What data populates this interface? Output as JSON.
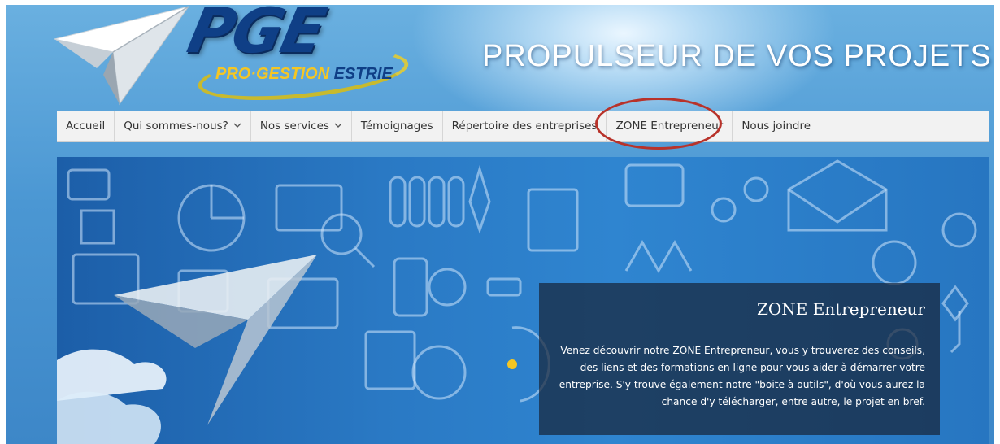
{
  "header": {
    "logo_text": "PGE",
    "logo_sub_pro": "PRO·GESTION",
    "logo_sub_estrie": "ESTRIE",
    "tagline": "PROPULSEUR DE VOS PROJETS"
  },
  "nav": {
    "items": [
      {
        "label": "Accueil"
      },
      {
        "label": "Qui sommes-nous?",
        "icon": "chevron-down-icon"
      },
      {
        "label": "Nos services",
        "icon": "chevron-down-icon"
      },
      {
        "label": "Témoignages"
      },
      {
        "label": "Répertoire des entreprises"
      },
      {
        "label": "ZONE Entrepreneur",
        "highlighted": true
      },
      {
        "label": "Nous joindre"
      }
    ]
  },
  "hero": {
    "caption_title": "ZONE Entrepreneur",
    "caption_text": "Venez découvrir notre ZONE Entrepreneur, vous y trouverez des conseils, des liens et des formations en ligne pour vous aider à démarrer votre entreprise. S'y trouve également notre \"boite à outils\", d'où vous aurez la chance d'y télécharger, entre autre, le projet en bref."
  },
  "colors": {
    "nav_bg": "#f2f2f2",
    "highlight_ring": "#b8322a",
    "logo_blue": "#0f3f86",
    "logo_gold": "#f5c623"
  }
}
